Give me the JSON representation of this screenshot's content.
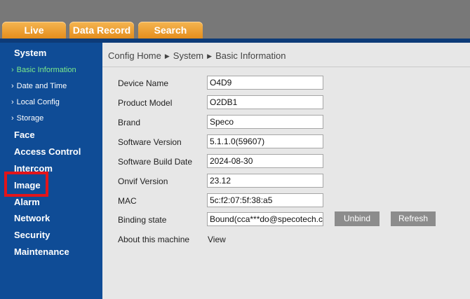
{
  "tabs": [
    {
      "label": "Live"
    },
    {
      "label": "Data Record"
    },
    {
      "label": "Search"
    }
  ],
  "sidebar": {
    "system": "System",
    "system_items": [
      {
        "label": "Basic Information",
        "active": true
      },
      {
        "label": "Date and Time"
      },
      {
        "label": "Local Config"
      },
      {
        "label": "Storage"
      }
    ],
    "chevron": "›",
    "face": "Face",
    "access_control": "Access Control",
    "intercom": "Intercom",
    "image": "Image",
    "alarm": "Alarm",
    "network": "Network",
    "security": "Security",
    "maintenance": "Maintenance"
  },
  "breadcrumb": {
    "home": "Config Home",
    "section": "System",
    "page": "Basic Information",
    "separator": "▶"
  },
  "form": {
    "device_name": {
      "label": "Device Name",
      "value": "O4D9"
    },
    "product_model": {
      "label": "Product Model",
      "value": "O2DB1"
    },
    "brand": {
      "label": "Brand",
      "value": "Speco"
    },
    "software_version": {
      "label": "Software Version",
      "value": "5.1.1.0(59607)"
    },
    "software_build_date": {
      "label": "Software Build Date",
      "value": "2024-08-30"
    },
    "onvif_version": {
      "label": "Onvif Version",
      "value": "23.12"
    },
    "mac": {
      "label": "MAC",
      "value": "5c:f2:07:5f:38:a5"
    },
    "binding_state": {
      "label": "Binding state",
      "value": "Bound(cca***do@specotech.com)"
    },
    "about": {
      "label": "About this machine",
      "link": "View"
    }
  },
  "buttons": {
    "unbind": "Unbind",
    "refresh": "Refresh"
  },
  "colors": {
    "sidebar_bg": "#0f4c96",
    "active_item": "#7bea8b",
    "tab_orange": "#e9951f",
    "highlight_box": "#e3151a"
  }
}
